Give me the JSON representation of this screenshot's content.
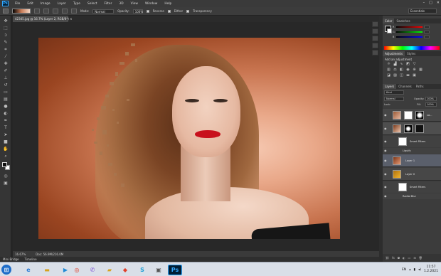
{
  "app": {
    "logo": "Ps",
    "menu": [
      "File",
      "Edit",
      "Image",
      "Layer",
      "Type",
      "Select",
      "Filter",
      "3D",
      "View",
      "Window",
      "Help"
    ],
    "window_controls": [
      "–",
      "□",
      "✕"
    ]
  },
  "options_bar": {
    "mode_label": "Mode:",
    "mode_value": "Normal",
    "opacity_label": "Opacity:",
    "opacity_value": "100%",
    "reverse_label": "Reverse",
    "dither_label": "Dither",
    "transparency_label": "Transparency",
    "workspace": "Essentials"
  },
  "document": {
    "tab_title": "42345.jpg @ 16.7% (Layer 2, RGB/8*) ×",
    "zoom": "16.67%",
    "doc_info": "Doc: 56.9M/216.0M"
  },
  "bottom_tabs": [
    "Mini Bridge",
    "Timeline"
  ],
  "panels": {
    "color_tabs": [
      "Color",
      "Swatches"
    ],
    "color_values": {
      "r": "",
      "g": "",
      "b": ""
    },
    "adjustments_tabs": [
      "Adjustments",
      "Styles"
    ],
    "adjustments_title": "Add an adjustment",
    "layers_tabs": [
      "Layers",
      "Channels",
      "Paths"
    ],
    "kind_label": "Kind",
    "blend_mode": "Normal",
    "opacity_label": "Opacity:",
    "opacity_value": "100%",
    "lock_label": "Lock:",
    "fill_label": "Fill:",
    "fill_value": "100%",
    "layers": [
      {
        "name": "La...",
        "type": "pixel-with-mask"
      },
      {
        "name": "",
        "type": "smart-object-with-mask"
      },
      {
        "name": "Smart Filters",
        "type": "sub"
      },
      {
        "name": "Liquify",
        "type": "sub"
      },
      {
        "name": "Layer 1",
        "type": "pixel"
      },
      {
        "name": "Layer 0",
        "type": "smart-object"
      },
      {
        "name": "Smart Filters",
        "type": "sub"
      },
      {
        "name": "Radial Blur",
        "type": "sub"
      }
    ]
  },
  "taskbar": {
    "language": "EN",
    "time": "11:57",
    "date": "1.2.2021",
    "colors": {
      "accent": "#31a8ff",
      "ps_bg": "#001d34"
    }
  }
}
